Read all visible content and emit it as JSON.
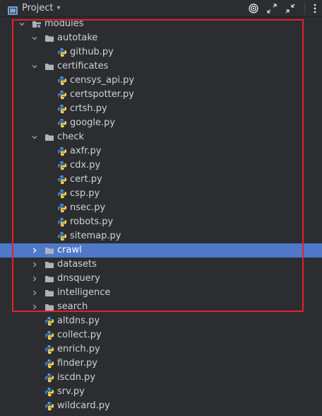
{
  "toolbar": {
    "title": "Project",
    "icons": [
      "project-folder-icon",
      "dropdown-icon",
      "target-icon",
      "expand-icon",
      "collapse-icon",
      "more-icon"
    ]
  },
  "tree": [
    {
      "label": "modules",
      "depth": 0,
      "type": "module",
      "expanded": true
    },
    {
      "label": "autotake",
      "depth": 1,
      "type": "folder",
      "expanded": true
    },
    {
      "label": "github.py",
      "depth": 2,
      "type": "py"
    },
    {
      "label": "certificates",
      "depth": 1,
      "type": "folder",
      "expanded": true
    },
    {
      "label": "censys_api.py",
      "depth": 2,
      "type": "py"
    },
    {
      "label": "certspotter.py",
      "depth": 2,
      "type": "py"
    },
    {
      "label": "crtsh.py",
      "depth": 2,
      "type": "py"
    },
    {
      "label": "google.py",
      "depth": 2,
      "type": "py"
    },
    {
      "label": "check",
      "depth": 1,
      "type": "folder",
      "expanded": true
    },
    {
      "label": "axfr.py",
      "depth": 2,
      "type": "py"
    },
    {
      "label": "cdx.py",
      "depth": 2,
      "type": "py"
    },
    {
      "label": "cert.py",
      "depth": 2,
      "type": "py"
    },
    {
      "label": "csp.py",
      "depth": 2,
      "type": "py"
    },
    {
      "label": "nsec.py",
      "depth": 2,
      "type": "py"
    },
    {
      "label": "robots.py",
      "depth": 2,
      "type": "py"
    },
    {
      "label": "sitemap.py",
      "depth": 2,
      "type": "py"
    },
    {
      "label": "crawl",
      "depth": 1,
      "type": "folder",
      "expanded": false,
      "selected": true
    },
    {
      "label": "datasets",
      "depth": 1,
      "type": "folder",
      "expanded": false
    },
    {
      "label": "dnsquery",
      "depth": 1,
      "type": "folder",
      "expanded": false
    },
    {
      "label": "intelligence",
      "depth": 1,
      "type": "folder",
      "expanded": false
    },
    {
      "label": "search",
      "depth": 1,
      "type": "folder",
      "expanded": false
    },
    {
      "label": "altdns.py",
      "depth": 1,
      "type": "py"
    },
    {
      "label": "collect.py",
      "depth": 1,
      "type": "py"
    },
    {
      "label": "enrich.py",
      "depth": 1,
      "type": "py"
    },
    {
      "label": "finder.py",
      "depth": 1,
      "type": "py"
    },
    {
      "label": "iscdn.py",
      "depth": 1,
      "type": "py"
    },
    {
      "label": "srv.py",
      "depth": 1,
      "type": "py"
    },
    {
      "label": "wildcard.py",
      "depth": 1,
      "type": "py"
    }
  ],
  "colors": {
    "background": "#2b2d30",
    "selection": "#4f78c8",
    "highlight_border": "#e5212b",
    "folder": "#aeb3b9",
    "python_blue": "#3d7ab8",
    "python_yellow": "#f2c94c"
  }
}
